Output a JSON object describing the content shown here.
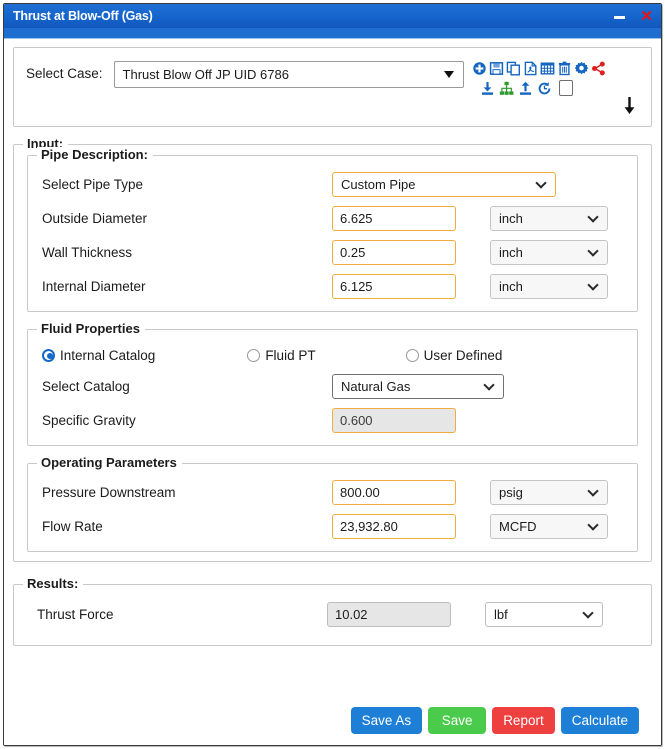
{
  "window": {
    "title": "Thrust at Blow-Off (Gas)",
    "minimize_label": "–",
    "close_label": "✕",
    "titlebar_color": "#1464cc"
  },
  "case_panel": {
    "label": "Select Case:",
    "selected_case": "Thrust Blow Off JP UID 6786",
    "toolbar_row1": [
      {
        "name": "add-icon",
        "title": "Add"
      },
      {
        "name": "save-icon",
        "title": "Save"
      },
      {
        "name": "copy-icon",
        "title": "Copy"
      },
      {
        "name": "pdf-icon",
        "title": "PDF"
      },
      {
        "name": "spreadsheet-icon",
        "title": "Spreadsheet"
      },
      {
        "name": "delete-icon",
        "title": "Delete"
      },
      {
        "name": "settings-icon",
        "title": "Settings"
      },
      {
        "name": "share-icon",
        "title": "Share"
      }
    ],
    "toolbar_row2": [
      {
        "name": "import-icon",
        "title": "Import"
      },
      {
        "name": "hierarchy-icon",
        "title": "Hierarchy"
      },
      {
        "name": "export-icon",
        "title": "Export"
      },
      {
        "name": "history-icon",
        "title": "History"
      },
      {
        "name": "checkbox",
        "title": "Checkbox"
      }
    ],
    "expand_arrow": "down-arrow-icon"
  },
  "input": {
    "legend": "Input:",
    "pipe_description": {
      "legend": "Pipe Description:",
      "rows": [
        {
          "label": "Select Pipe Type",
          "kind": "select",
          "value": "Custom Pipe",
          "unit": null
        },
        {
          "label": "Outside Diameter",
          "kind": "text",
          "value": "6.625",
          "unit": "inch"
        },
        {
          "label": "Wall Thickness",
          "kind": "text",
          "value": "0.25",
          "unit": "inch"
        },
        {
          "label": "Internal Diameter",
          "kind": "text",
          "value": "6.125",
          "unit": "inch"
        }
      ]
    },
    "fluid_properties": {
      "legend": "Fluid Properties",
      "radios": [
        {
          "label": "Internal Catalog",
          "selected": true
        },
        {
          "label": "Fluid PT",
          "selected": false
        },
        {
          "label": "User Defined",
          "selected": false
        }
      ],
      "catalog_label": "Select Catalog",
      "catalog_value": "Natural Gas",
      "specific_gravity_label": "Specific Gravity",
      "specific_gravity_value": "0.600"
    },
    "operating_parameters": {
      "legend": "Operating Parameters",
      "rows": [
        {
          "label": "Pressure Downstream",
          "value": "800.00",
          "unit": "psig"
        },
        {
          "label": "Flow Rate",
          "value": "23,932.80",
          "unit": "MCFD"
        }
      ]
    }
  },
  "results": {
    "legend": "Results:",
    "thrust_force_label": "Thrust Force",
    "thrust_force_value": "10.02",
    "thrust_force_unit": "lbf"
  },
  "footer": {
    "save_as": "Save As",
    "save": "Save",
    "report": "Report",
    "calculate": "Calculate",
    "colors": {
      "blue": "#1d7fd6",
      "green": "#4bcb4b",
      "red": "#ef4040"
    }
  }
}
